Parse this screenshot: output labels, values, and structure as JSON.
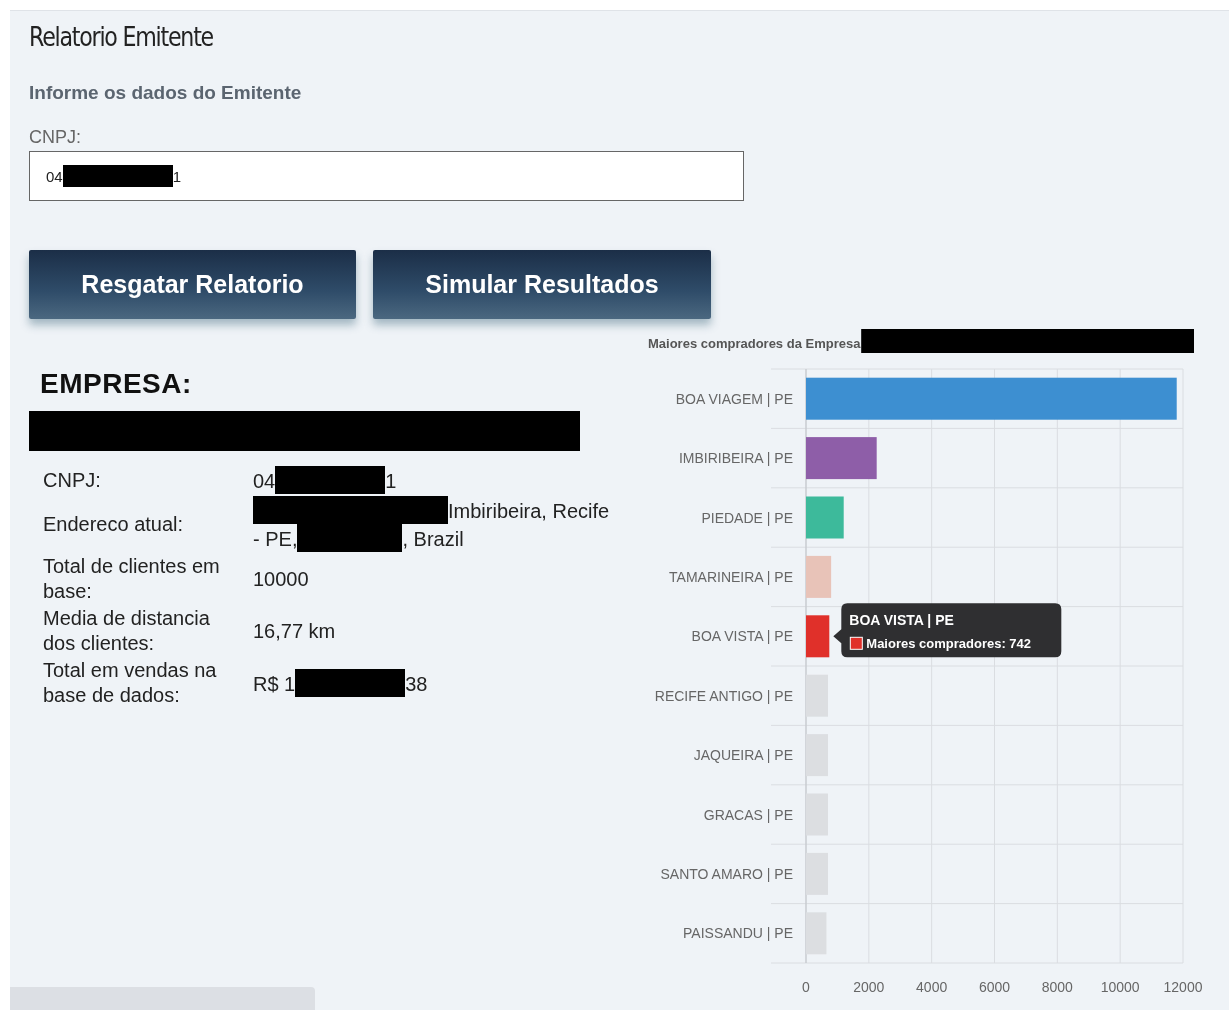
{
  "page": {
    "title": "Relatorio Emitente",
    "subtitle": "Informe os dados do Emitente"
  },
  "form": {
    "cnpj_label": "CNPJ:",
    "cnpj_value": [
      {
        "kind": "text",
        "text": "04"
      },
      {
        "kind": "redacted"
      },
      {
        "kind": "text",
        "text": "1"
      }
    ]
  },
  "buttons": [
    {
      "label": "Resgatar Relatorio"
    },
    {
      "label": "Simular Resultados"
    }
  ],
  "company": {
    "heading": "EMPRESA:",
    "name": [
      {
        "kind": "redacted"
      }
    ],
    "fields": [
      {
        "label": "CNPJ:",
        "value": [
          {
            "kind": "text",
            "text": "04"
          },
          {
            "kind": "redacted"
          },
          {
            "kind": "text",
            "text": "1"
          }
        ]
      },
      {
        "label": "Endereco atual:",
        "value": [
          {
            "kind": "redacted"
          },
          {
            "kind": "text",
            "text": "Imbiribeira, Recife"
          },
          {
            "kind": "text",
            "text": "- PE,"
          },
          {
            "kind": "redacted"
          },
          {
            "kind": "text",
            "text": ", Brazil"
          }
        ]
      },
      {
        "label": "Total de clientes em base:",
        "value": [
          {
            "kind": "text",
            "text": "10000"
          }
        ]
      },
      {
        "label": "Media de distancia dos clientes:",
        "value": [
          {
            "kind": "text",
            "text": "16,77 km"
          }
        ]
      },
      {
        "label": "Total em vendas na base de dados:",
        "value": [
          {
            "kind": "text",
            "text": "R$ 1"
          },
          {
            "kind": "redacted"
          },
          {
            "kind": "text",
            "text": "38"
          }
        ]
      }
    ]
  },
  "chart": {
    "title_redacted": true,
    "bars": [
      {
        "color": "#3d8fd1"
      },
      {
        "color": "#8e5ea8"
      },
      {
        "color": "#3dba9b"
      },
      {
        "color": "#e8c3b8"
      },
      {
        "color": "#e0302a",
        "tooltip": {
          "title": "BOA VISTA | PE",
          "text": "Maiores compradores: 742"
        }
      },
      {
        "color": "#dcdee1"
      },
      {
        "color": "#dcdee1"
      },
      {
        "color": "#dcdee1"
      },
      {
        "color": "#dcdee1"
      },
      {
        "color": "#dcdee1"
      }
    ],
    "chart_data": {
      "type": "bar",
      "orientation": "horizontal",
      "title": "Maiores compradores da Empresa",
      "categories": [
        "BOA VIAGEM | PE",
        "IMBIRIBEIRA | PE",
        "PIEDADE | PE",
        "TAMARINEIRA | PE",
        "BOA VISTA | PE",
        "RECIFE ANTIGO | PE",
        "JAQUEIRA | PE",
        "GRACAS | PE",
        "SANTO AMARO | PE",
        "PAISSANDU | PE"
      ],
      "series": [
        {
          "values": [
            11800,
            2250,
            1200,
            800,
            742,
            700,
            700,
            700,
            700,
            650
          ]
        }
      ],
      "grid": true,
      "xlim": [
        0,
        12000
      ],
      "xticks": [
        0,
        2000,
        4000,
        6000,
        8000,
        10000,
        12000
      ]
    }
  }
}
